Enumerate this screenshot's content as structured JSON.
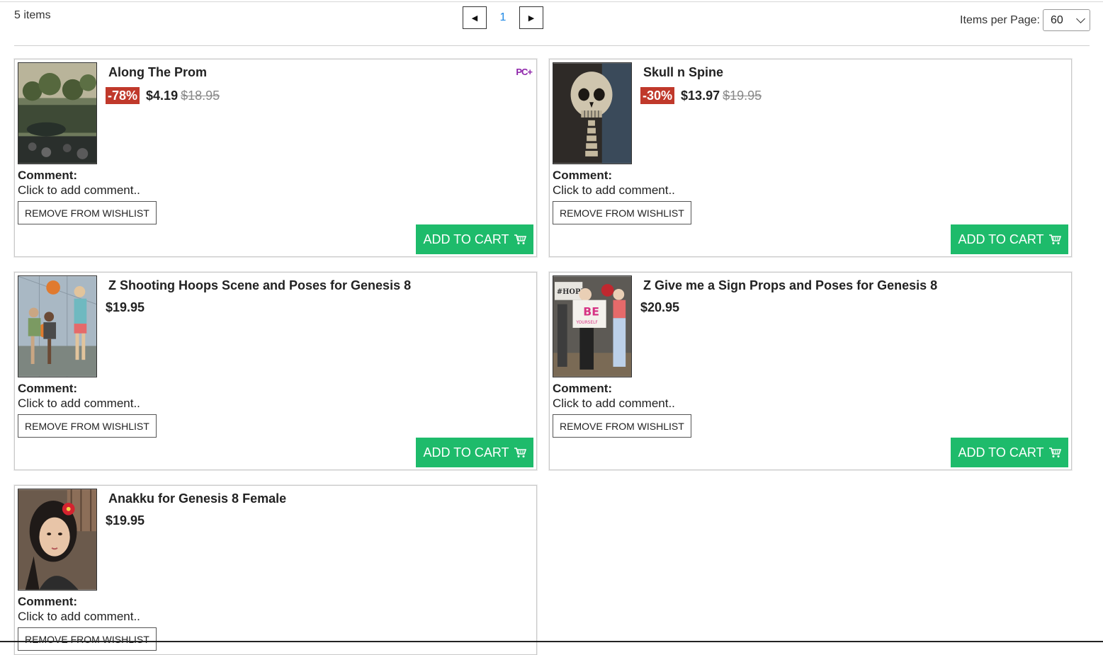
{
  "header": {
    "item_count": "5 items",
    "pagination": {
      "prev_icon": "◀",
      "current_page": "1",
      "next_icon": "▶"
    },
    "items_per_page": {
      "label": "Items per Page:",
      "value": "60"
    }
  },
  "items": [
    {
      "title": "Along The Prom",
      "discount": "-78%",
      "price": "$4.19",
      "original_price": "$18.95",
      "badge": "PC+",
      "comment_label": "Comment:",
      "comment_text": "Click to add comment..",
      "remove_label": "REMOVE FROM WISHLIST",
      "cart_label": "ADD TO CART",
      "thumb_icon": "garden-scene-image"
    },
    {
      "title": "Skull n Spine",
      "discount": "-30%",
      "price": "$13.97",
      "original_price": "$19.95",
      "comment_label": "Comment:",
      "comment_text": "Click to add comment..",
      "remove_label": "REMOVE FROM WISHLIST",
      "cart_label": "ADD TO CART",
      "thumb_icon": "skull-image"
    },
    {
      "title": "Z Shooting Hoops Scene and Poses for Genesis 8",
      "price": "$19.95",
      "comment_label": "Comment:",
      "comment_text": "Click to add comment..",
      "remove_label": "REMOVE FROM WISHLIST",
      "cart_label": "ADD TO CART",
      "thumb_icon": "basketball-scene-image"
    },
    {
      "title": "Z Give me a Sign Props and Poses for Genesis 8",
      "price": "$20.95",
      "comment_label": "Comment:",
      "comment_text": "Click to add comment..",
      "remove_label": "REMOVE FROM WISHLIST",
      "cart_label": "ADD TO CART",
      "thumb_icon": "sign-protest-image",
      "thumb_text": {
        "sign_top": "#HOPE",
        "sign_main": "BE",
        "sign_sub": "YOURSELF"
      }
    },
    {
      "title": "Anakku for Genesis 8 Female",
      "price": "$19.95",
      "comment_label": "Comment:",
      "comment_text": "Click to add comment..",
      "remove_label": "REMOVE FROM WISHLIST",
      "thumb_icon": "female-portrait-image"
    }
  ],
  "colors": {
    "discount_bg": "#c0392b",
    "cart_green": "#1ebb6b",
    "pagination_accent": "#1e88e5",
    "badge_purple": "#8e24aa"
  }
}
